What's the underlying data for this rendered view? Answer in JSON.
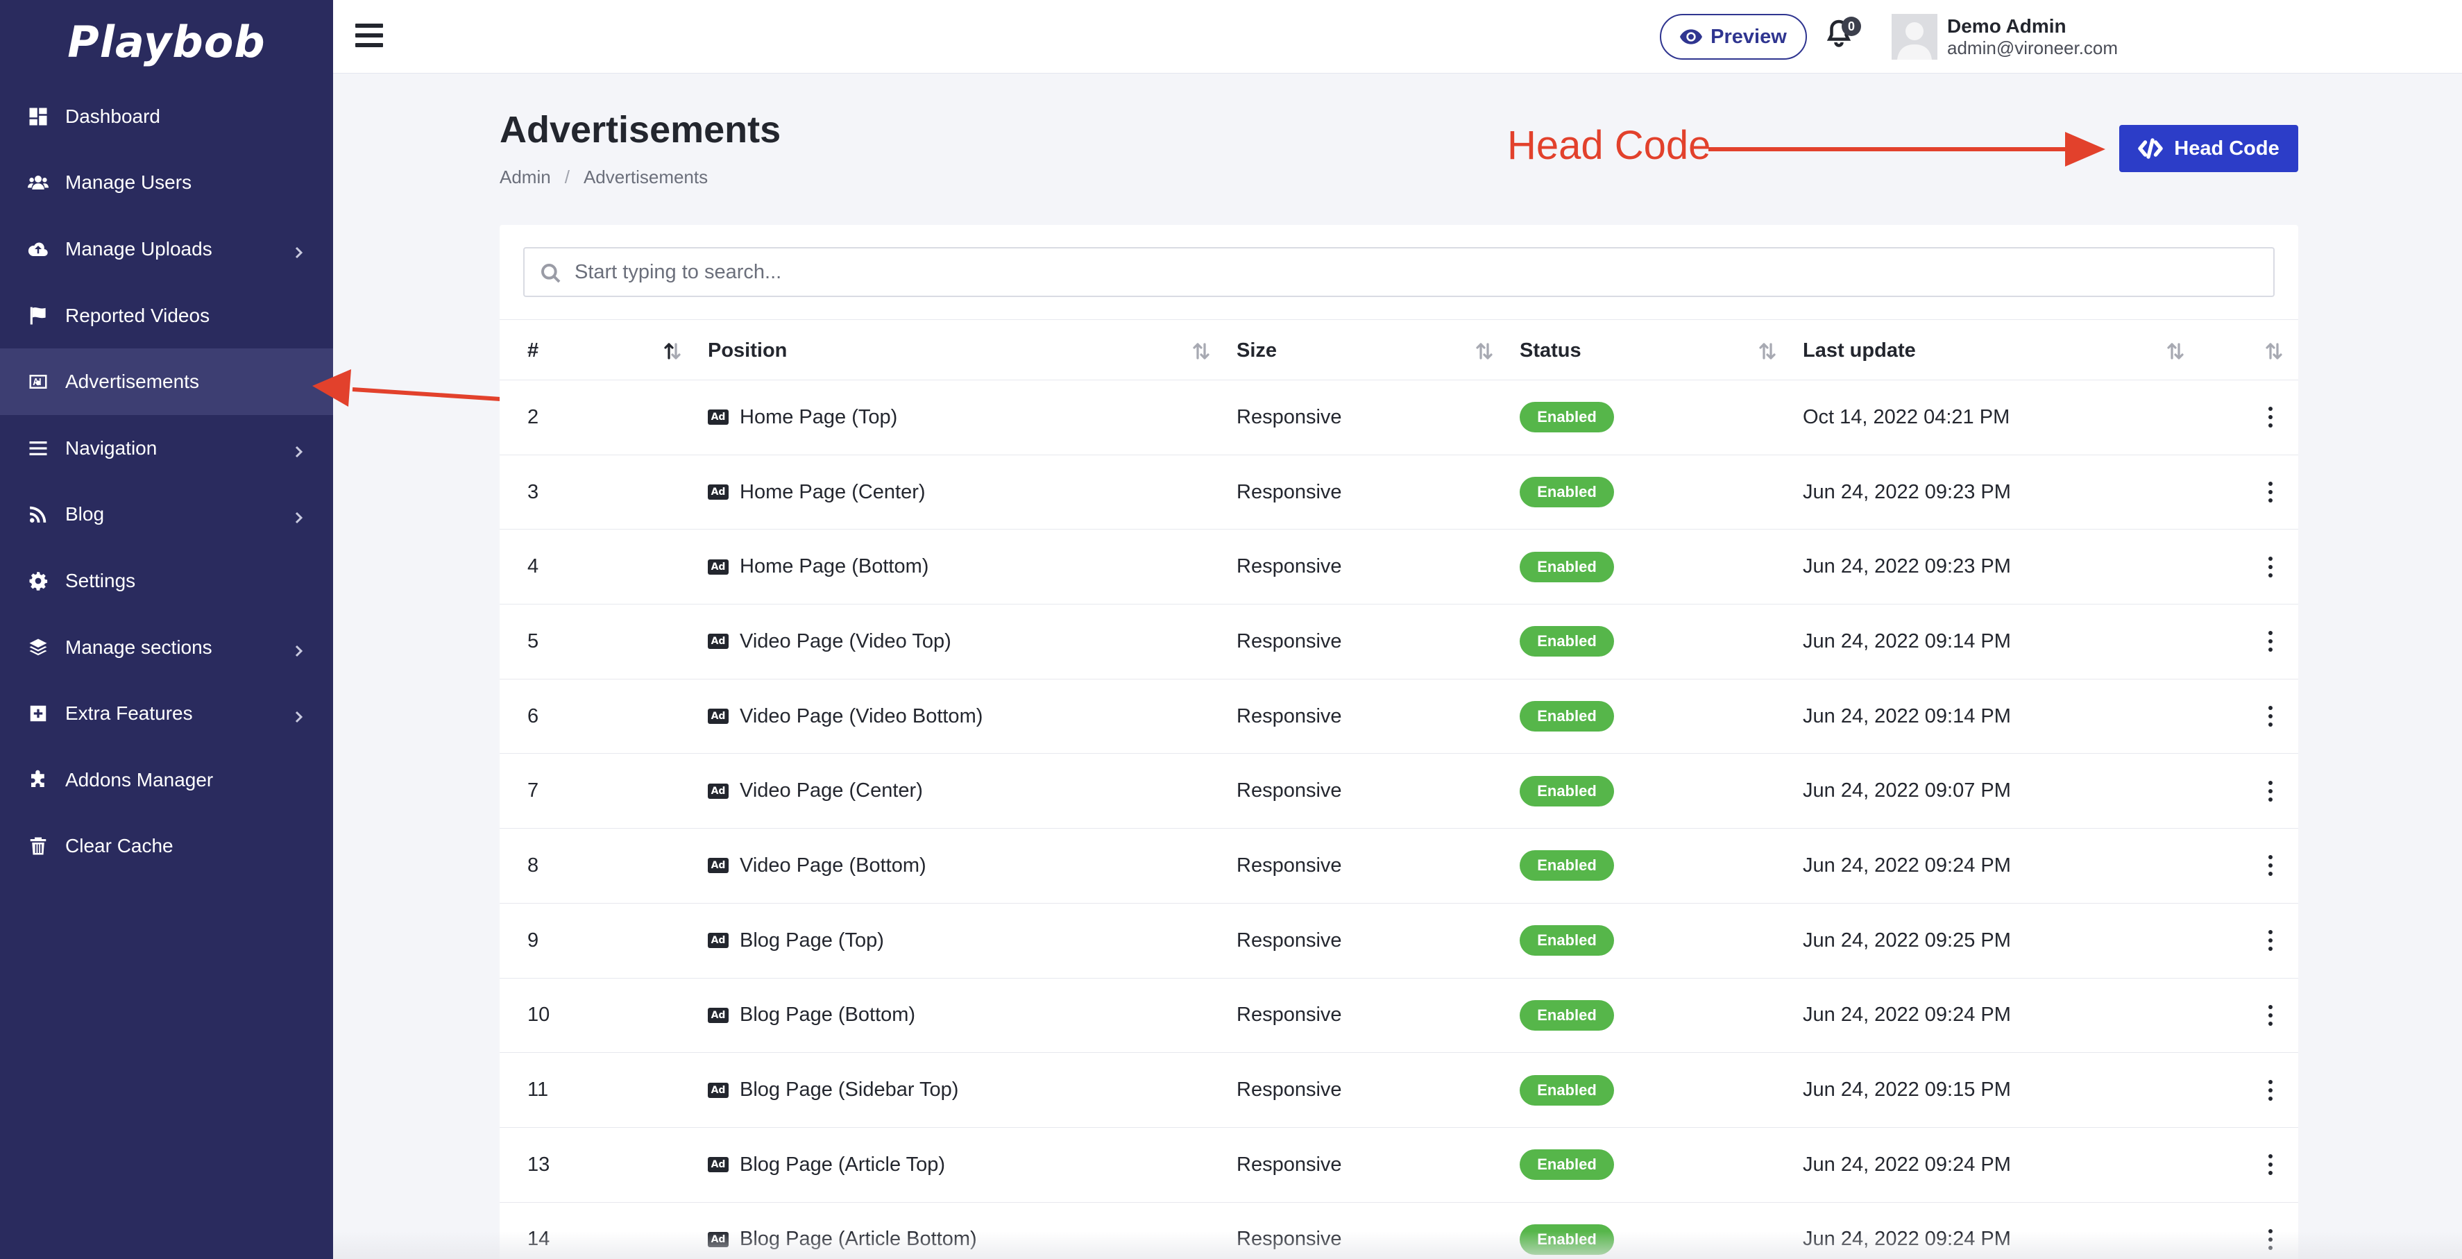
{
  "sidebar": {
    "logo": "Playbob",
    "items": [
      {
        "label": "Dashboard",
        "icon": "dashboard-icon",
        "chevron": false,
        "active": false
      },
      {
        "label": "Manage Users",
        "icon": "users-icon",
        "chevron": false,
        "active": false
      },
      {
        "label": "Manage Uploads",
        "icon": "cloud-upload-icon",
        "chevron": true,
        "active": false
      },
      {
        "label": "Reported Videos",
        "icon": "flag-icon",
        "chevron": false,
        "active": false
      },
      {
        "label": "Advertisements",
        "icon": "ad-icon",
        "chevron": false,
        "active": true
      },
      {
        "label": "Navigation",
        "icon": "list-icon",
        "chevron": true,
        "active": false
      },
      {
        "label": "Blog",
        "icon": "rss-icon",
        "chevron": true,
        "active": false
      },
      {
        "label": "Settings",
        "icon": "gear-icon",
        "chevron": false,
        "active": false
      },
      {
        "label": "Manage sections",
        "icon": "layers-icon",
        "chevron": true,
        "active": false
      },
      {
        "label": "Extra Features",
        "icon": "plus-square-icon",
        "chevron": true,
        "active": false
      },
      {
        "label": "Addons Manager",
        "icon": "puzzle-icon",
        "chevron": false,
        "active": false
      },
      {
        "label": "Clear Cache",
        "icon": "trash-icon",
        "chevron": false,
        "active": false
      }
    ]
  },
  "topbar": {
    "preview_label": "Preview",
    "notification_count": "0",
    "user_name": "Demo Admin",
    "user_email": "admin@vironeer.com"
  },
  "page": {
    "title": "Advertisements",
    "breadcrumb": [
      "Admin",
      "Advertisements"
    ],
    "head_code_label": "Head Code"
  },
  "annotation": {
    "label": "Head Code",
    "color": "#e2412c"
  },
  "search": {
    "placeholder": "Start typing to search..."
  },
  "table": {
    "headers": [
      "#",
      "Position",
      "Size",
      "Status",
      "Last update"
    ],
    "rows": [
      {
        "id": "2",
        "position": "Home Page (Top)",
        "size": "Responsive",
        "status": "Enabled",
        "updated": "Oct 14, 2022 04:21 PM"
      },
      {
        "id": "3",
        "position": "Home Page (Center)",
        "size": "Responsive",
        "status": "Enabled",
        "updated": "Jun 24, 2022 09:23 PM"
      },
      {
        "id": "4",
        "position": "Home Page (Bottom)",
        "size": "Responsive",
        "status": "Enabled",
        "updated": "Jun 24, 2022 09:23 PM"
      },
      {
        "id": "5",
        "position": "Video Page (Video Top)",
        "size": "Responsive",
        "status": "Enabled",
        "updated": "Jun 24, 2022 09:14 PM"
      },
      {
        "id": "6",
        "position": "Video Page (Video Bottom)",
        "size": "Responsive",
        "status": "Enabled",
        "updated": "Jun 24, 2022 09:14 PM"
      },
      {
        "id": "7",
        "position": "Video Page (Center)",
        "size": "Responsive",
        "status": "Enabled",
        "updated": "Jun 24, 2022 09:07 PM"
      },
      {
        "id": "8",
        "position": "Video Page (Bottom)",
        "size": "Responsive",
        "status": "Enabled",
        "updated": "Jun 24, 2022 09:24 PM"
      },
      {
        "id": "9",
        "position": "Blog Page (Top)",
        "size": "Responsive",
        "status": "Enabled",
        "updated": "Jun 24, 2022 09:25 PM"
      },
      {
        "id": "10",
        "position": "Blog Page (Bottom)",
        "size": "Responsive",
        "status": "Enabled",
        "updated": "Jun 24, 2022 09:24 PM"
      },
      {
        "id": "11",
        "position": "Blog Page (Sidebar Top)",
        "size": "Responsive",
        "status": "Enabled",
        "updated": "Jun 24, 2022 09:15 PM"
      },
      {
        "id": "13",
        "position": "Blog Page (Article Top)",
        "size": "Responsive",
        "status": "Enabled",
        "updated": "Jun 24, 2022 09:24 PM"
      },
      {
        "id": "14",
        "position": "Blog Page (Article Bottom)",
        "size": "Responsive",
        "status": "Enabled",
        "updated": "Jun 24, 2022 09:24 PM"
      }
    ]
  },
  "colors": {
    "sidebar_bg": "#2a2b5e",
    "sidebar_active": "#3d3e72",
    "primary": "#2c3dc8",
    "badge_green": "#56b64a"
  }
}
